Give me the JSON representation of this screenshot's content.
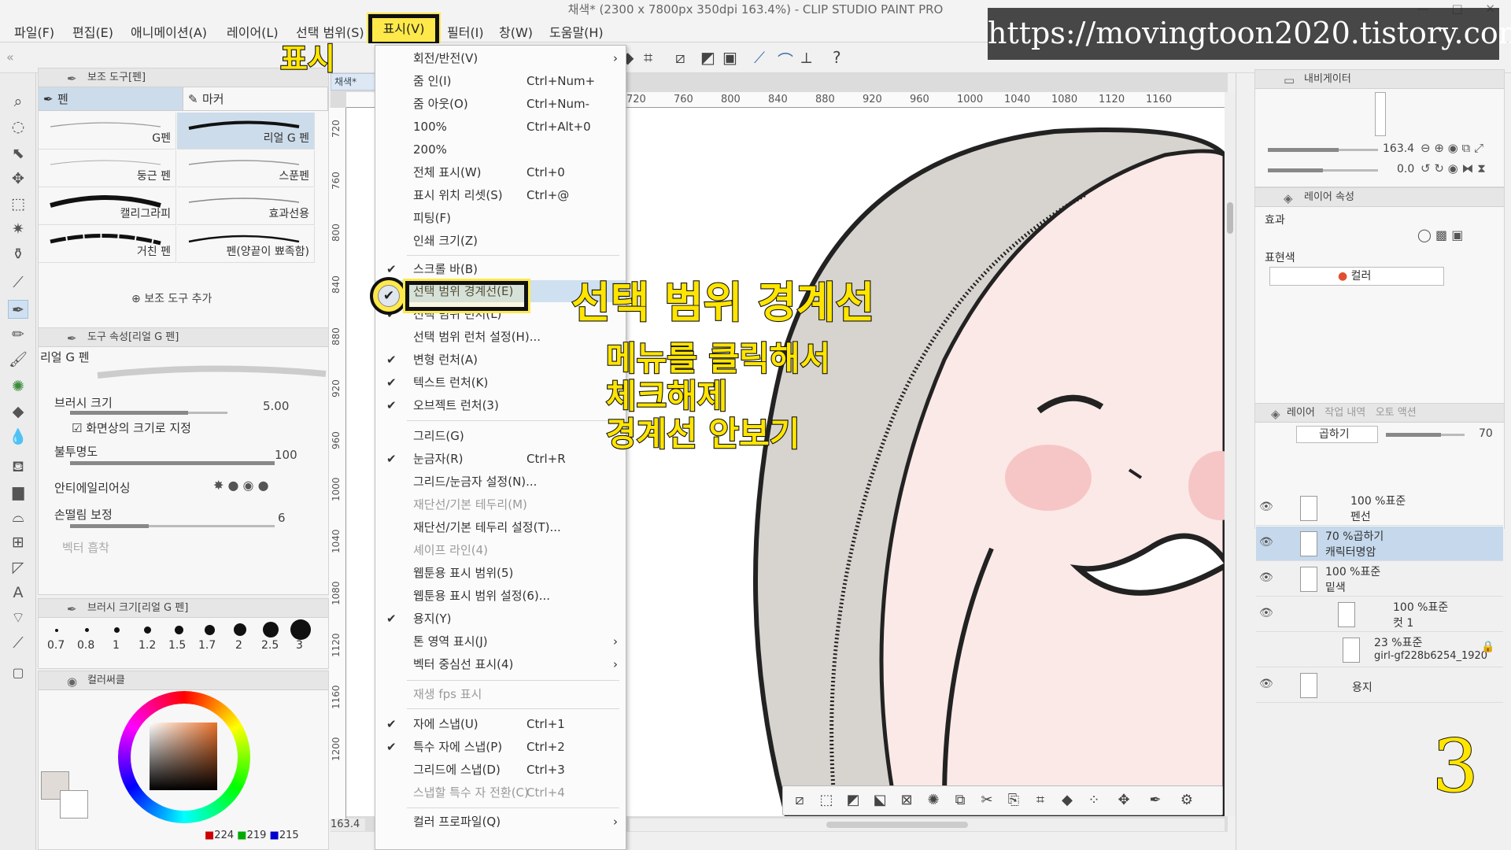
{
  "window": {
    "title": "채색* (2300 x 7800px 350dpi 163.4%)  - CLIP STUDIO PAINT PRO",
    "controls": "—  □  ✕"
  },
  "menubar": {
    "items": [
      "파일(F)",
      "편집(E)",
      "애니메이션(A)",
      "레이어(L)",
      "선택 범위(S)",
      "표시(V)",
      "필터(I)",
      "창(W)",
      "도움말(H)"
    ]
  },
  "annotations": {
    "view_label": "표시",
    "callout_title": "선택 범위 경계선",
    "instruction_1": "메뉴를 클릭해서",
    "instruction_2": "체크해제",
    "instruction_3": "경계선 안보기",
    "watermark": "https://movingtoon2020.tistory.com",
    "step_number": "3"
  },
  "view_menu": {
    "items": [
      {
        "label": "회전/반전(V)",
        "shortcut": "",
        "checked": false,
        "disabled": false,
        "submenu": true
      },
      {
        "label": "줌 인(I)",
        "shortcut": "Ctrl+Num+",
        "checked": false,
        "disabled": false
      },
      {
        "label": "줌 아웃(O)",
        "shortcut": "Ctrl+Num-",
        "checked": false,
        "disabled": false
      },
      {
        "label": "100%",
        "shortcut": "Ctrl+Alt+0",
        "checked": false,
        "disabled": false
      },
      {
        "label": "200%",
        "shortcut": "",
        "checked": false,
        "disabled": false
      },
      {
        "label": "전체 표시(W)",
        "shortcut": "Ctrl+0",
        "checked": false,
        "disabled": false
      },
      {
        "label": "표시 위치 리셋(S)",
        "shortcut": "Ctrl+@",
        "checked": false,
        "disabled": false
      },
      {
        "label": "피팅(F)",
        "shortcut": "",
        "checked": false,
        "disabled": false
      },
      {
        "label": "인쇄 크기(Z)",
        "shortcut": "",
        "checked": false,
        "disabled": false
      },
      {
        "label": "스크롤 바(B)",
        "shortcut": "",
        "checked": true,
        "disabled": false
      },
      {
        "label": "선택 범위 경계선(E)",
        "shortcut": "",
        "checked": true,
        "disabled": false,
        "highlighted": true
      },
      {
        "label": "선택 범위 런처(L)",
        "shortcut": "",
        "checked": true,
        "disabled": false
      },
      {
        "label": "선택 범위 런처 설정(H)...",
        "shortcut": "",
        "checked": false,
        "disabled": false
      },
      {
        "label": "변형 런처(A)",
        "shortcut": "",
        "checked": true,
        "disabled": false
      },
      {
        "label": "텍스트 런처(K)",
        "shortcut": "",
        "checked": true,
        "disabled": false
      },
      {
        "label": "오브젝트 런처(3)",
        "shortcut": "",
        "checked": true,
        "disabled": false
      },
      {
        "label": "그리드(G)",
        "shortcut": "",
        "checked": false,
        "disabled": false
      },
      {
        "label": "눈금자(R)",
        "shortcut": "Ctrl+R",
        "checked": true,
        "disabled": false
      },
      {
        "label": "그리드/눈금자 설정(N)...",
        "shortcut": "",
        "checked": false,
        "disabled": false
      },
      {
        "label": "재단선/기본 테두리(M)",
        "shortcut": "",
        "checked": false,
        "disabled": true
      },
      {
        "label": "재단선/기본 테두리 설정(T)...",
        "shortcut": "",
        "checked": false,
        "disabled": false
      },
      {
        "label": "셰이프 라인(4)",
        "shortcut": "",
        "checked": false,
        "disabled": true
      },
      {
        "label": "웹툰용 표시 범위(5)",
        "shortcut": "",
        "checked": false,
        "disabled": false
      },
      {
        "label": "웹툰용 표시 범위 설정(6)...",
        "shortcut": "",
        "checked": false,
        "disabled": false
      },
      {
        "label": "용지(Y)",
        "shortcut": "",
        "checked": true,
        "disabled": false
      },
      {
        "label": "톤 영역 표시(J)",
        "shortcut": "",
        "checked": false,
        "disabled": false,
        "submenu": true
      },
      {
        "label": "벡터 중심선 표시(4)",
        "shortcut": "",
        "checked": false,
        "disabled": false,
        "submenu": true
      },
      {
        "label": "재생 fps 표시",
        "shortcut": "",
        "checked": false,
        "disabled": true
      },
      {
        "label": "자에 스냅(U)",
        "shortcut": "Ctrl+1",
        "checked": true,
        "disabled": false
      },
      {
        "label": "특수 자에 스냅(P)",
        "shortcut": "Ctrl+2",
        "checked": true,
        "disabled": false
      },
      {
        "label": "그리드에 스냅(D)",
        "shortcut": "Ctrl+3",
        "checked": false,
        "disabled": false
      },
      {
        "label": "스냅할 특수 자 전환(C)",
        "shortcut": "Ctrl+4",
        "checked": false,
        "disabled": true
      },
      {
        "label": "컬러 프로파일(Q)",
        "shortcut": "",
        "checked": false,
        "disabled": false,
        "submenu": true
      }
    ]
  },
  "subtool_panel": {
    "title": "보조 도구[펜]",
    "tabs": [
      "펜",
      "마커"
    ],
    "brushes": [
      "G펜",
      "리얼 G 펜",
      "둥근 펜",
      "스푼펜",
      "캘리그라피",
      "효과선용",
      "거친 펜",
      "펜(양끝이 뾰족함)"
    ],
    "add_label": "보조 도구 추가"
  },
  "tool_property": {
    "title": "도구 속성[리얼 G 펜]",
    "tool_name": "리얼 G 펜",
    "brush_size_label": "브러시 크기",
    "brush_size_value": "5.00",
    "screen_size_label": "화면상의 크기로 지정",
    "opacity_label": "불투명도",
    "opacity_value": "100",
    "antialias_label": "안티에일리어싱",
    "stabilization_label": "손떨림 보정",
    "stabilization_value": "6",
    "vector_label": "벡터 흡착"
  },
  "brush_size_panel": {
    "title": "브러시 크기[리얼 G 펜]",
    "sizes": [
      "0.7",
      "0.8",
      "1",
      "1.2",
      "1.5",
      "1.7",
      "2",
      "2.5",
      "3"
    ]
  },
  "color_panel": {
    "title": "컬러써클",
    "rgb_r": "224",
    "rgb_g": "219",
    "rgb_b": "215"
  },
  "canvas": {
    "tab_label": "채색*",
    "zoom": "163.4",
    "ruler_top": [
      "720",
      "760",
      "800",
      "840",
      "880",
      "920",
      "960",
      "1000",
      "1040",
      "1080",
      "1120",
      "1160"
    ],
    "ruler_left": [
      "720",
      "760",
      "800",
      "840",
      "880",
      "920",
      "960",
      "1000",
      "1040",
      "1080",
      "1120",
      "1160",
      "1200"
    ]
  },
  "navigator": {
    "title": "내비게이터",
    "zoom_value": "163.4",
    "rotation_value": "0.0"
  },
  "layer_property": {
    "title": "레이어 속성",
    "effect_label": "효과",
    "expression_label": "표현색",
    "expression_value": "컬러"
  },
  "layer_panel": {
    "tabs": [
      "레이어",
      "작업 내역",
      "오토 액션"
    ],
    "blend_mode": "곱하기",
    "opacity": "70",
    "layers": [
      {
        "mode": "100 %표준",
        "name": "펜선",
        "selected": false
      },
      {
        "mode": "70 %곱하기",
        "name": "캐릭터명암",
        "selected": true
      },
      {
        "mode": "100 %표준",
        "name": "밑색",
        "selected": false
      },
      {
        "mode": "100 %표준",
        "name": "컷 1",
        "selected": false
      },
      {
        "mode": "23 %표준",
        "name": "girl-gf228b6254_1920",
        "selected": false
      },
      {
        "mode": "",
        "name": "용지",
        "selected": false
      }
    ]
  }
}
